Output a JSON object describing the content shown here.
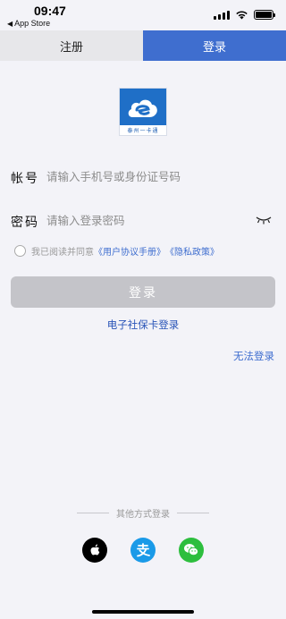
{
  "status_bar": {
    "time": "09:47",
    "back_app": "App Store"
  },
  "tabs": [
    {
      "label": "注册",
      "active": false
    },
    {
      "label": "登录",
      "active": true
    }
  ],
  "logo": {
    "caption": "泰州一卡通"
  },
  "form": {
    "account_label": "帐号",
    "account_placeholder": "请输入手机号或身份证号码",
    "password_label": "密码",
    "password_placeholder": "请输入登录密码"
  },
  "agreement": {
    "prefix": "我已阅读并同意",
    "user_agreement": "《用户协议手册》",
    "privacy_policy": "《隐私政策》"
  },
  "login_button": "登录",
  "social_card_login": "电子社保卡登录",
  "cannot_login": "无法登录",
  "other_methods": {
    "title": "其他方式登录",
    "icons": [
      "apple-icon",
      "alipay-icon",
      "wechat-icon"
    ]
  },
  "colors": {
    "primary": "#3f6ecf",
    "disabled_button": "#c4c4c9",
    "alipay": "#1a9ae8",
    "wechat": "#2dbe3e"
  }
}
